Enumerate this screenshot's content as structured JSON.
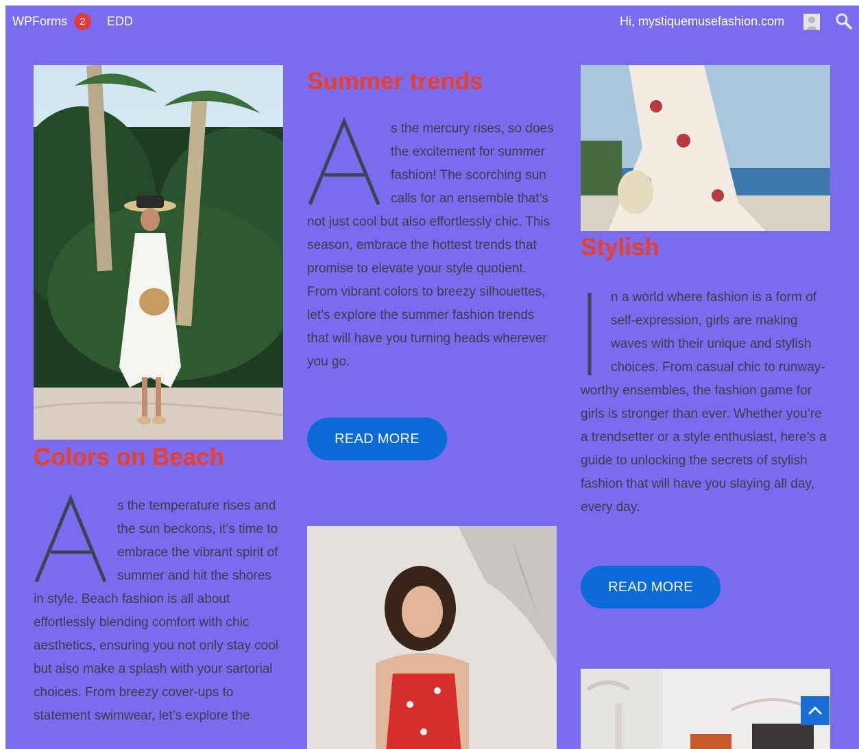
{
  "adminbar": {
    "wpforms_label": "WPForms",
    "wpforms_count": "2",
    "edd_label": "EDD",
    "greeting": "Hi, mystiquemusefashion.com"
  },
  "posts": [
    {
      "title": "Colors on Beach",
      "dropcap": "A",
      "excerpt": "s the temperature rises and the sun beckons, it’s time to embrace the vibrant spirit of summer and hit the shores in style. Beach fashion is all about effortlessly blending comfort with chic aesthetics, ensuring you not only stay cool but also make a splash with your sartorial choices. From breezy cover-ups to statement swimwear, let’s explore the"
    },
    {
      "title": "Summer trends",
      "dropcap": "A",
      "excerpt": "s the mercury rises, so does the excitement for summer fashion! The scorching sun calls for an ensemble that’s not just cool but also effortlessly chic. This season, embrace the hottest trends that promise to elevate your style quotient. From vibrant colors to breezy silhouettes, let’s explore the summer fashion trends that will have you turning heads wherever you go.",
      "button": "READ MORE"
    },
    {
      "title": "Stylish",
      "dropcap": "I",
      "excerpt": "n a world where fashion is a form of self-expression, girls are making waves with their unique and stylish choices. From casual chic to runway-worthy ensembles, the fashion game for girls is stronger than ever. Whether you’re a trendsetter or a style enthusiast, here’s a guide to unlocking the secrets of stylish fashion that will have you slaying all day, every day.",
      "button": "READ MORE"
    }
  ],
  "colors": {
    "background": "#7a6bef",
    "title": "#ee3f24",
    "body_text": "#3a3e4a",
    "button": "#0a6ad8"
  },
  "icons": [
    "avatar-icon",
    "search-icon",
    "chevron-up-icon"
  ]
}
